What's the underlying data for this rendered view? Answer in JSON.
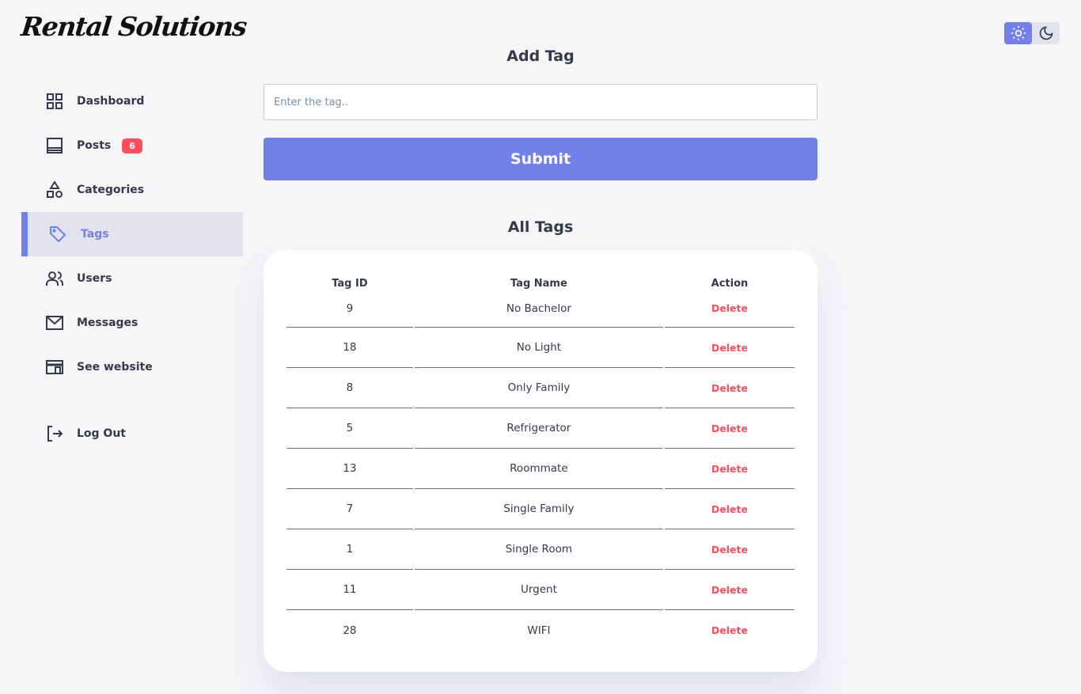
{
  "brand": {
    "name": "Rental Solutions"
  },
  "sidebar": {
    "items": [
      {
        "label": "Dashboard",
        "icon": "dashboard-grid-icon"
      },
      {
        "label": "Posts",
        "icon": "posts-icon",
        "badge": "6"
      },
      {
        "label": "Categories",
        "icon": "categories-shapes-icon"
      },
      {
        "label": "Tags",
        "icon": "tag-icon",
        "active": true
      },
      {
        "label": "Users",
        "icon": "users-icon"
      },
      {
        "label": "Messages",
        "icon": "mail-icon"
      },
      {
        "label": "See website",
        "icon": "website-icon"
      }
    ],
    "logout": {
      "label": "Log Out",
      "icon": "logout-icon"
    }
  },
  "theme_toggle": {
    "active": "light",
    "light_icon": "sun-icon",
    "dark_icon": "moon-icon"
  },
  "add_tag": {
    "title": "Add Tag",
    "placeholder": "Enter the tag..",
    "submit_label": "Submit"
  },
  "all_tags": {
    "title": "All Tags",
    "columns": [
      "Tag ID",
      "Tag Name",
      "Action"
    ],
    "rows": [
      {
        "id": "9",
        "name": "No Bachelor",
        "action": "Delete"
      },
      {
        "id": "18",
        "name": "No Light",
        "action": "Delete"
      },
      {
        "id": "8",
        "name": "Only Family",
        "action": "Delete"
      },
      {
        "id": "5",
        "name": "Refrigerator",
        "action": "Delete"
      },
      {
        "id": "13",
        "name": "Roommate",
        "action": "Delete"
      },
      {
        "id": "7",
        "name": "Single Family",
        "action": "Delete"
      },
      {
        "id": "1",
        "name": "Single Room",
        "action": "Delete"
      },
      {
        "id": "11",
        "name": "Urgent",
        "action": "Delete"
      },
      {
        "id": "28",
        "name": "WIFI",
        "action": "Delete"
      }
    ]
  },
  "colors": {
    "primary": "#7380ec",
    "danger": "#ff4d5e",
    "background": "#f6f6f9",
    "text": "#363949"
  }
}
